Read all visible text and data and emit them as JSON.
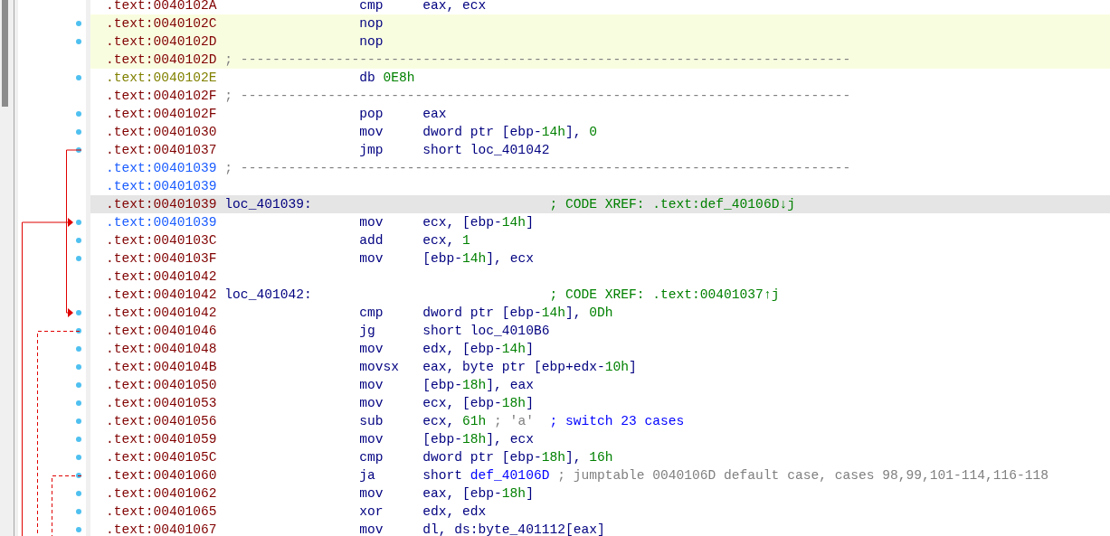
{
  "rows": [
    {
      "address": ".text:0040102A",
      "color": "#800000",
      "kind": "instruction",
      "marker": false,
      "marked": false,
      "selected": false,
      "mnemonic": "cmp",
      "operands": [
        {
          "text": "eax, ecx",
          "kind": "text"
        }
      ]
    },
    {
      "address": ".text:0040102C",
      "color": "#800000",
      "kind": "instruction",
      "marker": true,
      "marked": true,
      "selected": false,
      "mnemonic": "nop"
    },
    {
      "address": ".text:0040102D",
      "color": "#800000",
      "kind": "instruction",
      "marker": true,
      "marked": true,
      "selected": false,
      "mnemonic": "nop"
    },
    {
      "address": ".text:0040102D",
      "color": "#800000",
      "kind": "separator",
      "marker": false,
      "marked": true,
      "selected": false,
      "comments": [
        {
          "text": "; -----------------------------------------------------------------------------",
          "kind": "auto"
        }
      ]
    },
    {
      "address": ".text:0040102E",
      "color": "#808000",
      "kind": "data",
      "marker": true,
      "marked": false,
      "selected": false,
      "mnemonic": "db",
      "operands": [
        {
          "text": "0E8h",
          "kind": "number"
        }
      ]
    },
    {
      "address": ".text:0040102F",
      "color": "#800000",
      "kind": "separator",
      "marker": false,
      "marked": false,
      "selected": false,
      "comments": [
        {
          "text": "; -----------------------------------------------------------------------------",
          "kind": "auto"
        }
      ]
    },
    {
      "address": ".text:0040102F",
      "color": "#800000",
      "kind": "instruction",
      "marker": true,
      "marked": false,
      "selected": false,
      "mnemonic": "pop",
      "operands": [
        {
          "text": "eax",
          "kind": "text"
        }
      ]
    },
    {
      "address": ".text:00401030",
      "color": "#800000",
      "kind": "instruction",
      "marker": true,
      "marked": false,
      "selected": false,
      "mnemonic": "mov",
      "operands": [
        {
          "text": "dword ptr [ebp-",
          "kind": "text"
        },
        {
          "text": "14h",
          "kind": "number"
        },
        {
          "text": "], ",
          "kind": "text"
        },
        {
          "text": "0",
          "kind": "number"
        }
      ]
    },
    {
      "address": ".text:00401037",
      "color": "#800000",
      "kind": "instruction",
      "marker": true,
      "marked": false,
      "selected": false,
      "mnemonic": "jmp",
      "operands": [
        {
          "text": "short loc_401042",
          "kind": "text"
        }
      ]
    },
    {
      "address": ".text:00401039",
      "color": "#1a5cff",
      "kind": "separator",
      "marker": false,
      "marked": false,
      "selected": false,
      "comments": [
        {
          "text": "; -----------------------------------------------------------------------------",
          "kind": "auto"
        }
      ]
    },
    {
      "address": ".text:00401039",
      "color": "#1a5cff",
      "kind": "blank",
      "marker": false,
      "marked": false,
      "selected": false
    },
    {
      "address": ".text:00401039",
      "color": "#800000",
      "kind": "label",
      "marker": false,
      "marked": false,
      "selected": true,
      "label": "loc_401039:",
      "comments": [
        {
          "text": "; CODE XREF: .text:def_40106D↓j",
          "kind": "xref"
        }
      ]
    },
    {
      "address": ".text:00401039",
      "color": "#1a5cff",
      "kind": "instruction",
      "marker": true,
      "marked": false,
      "selected": false,
      "mnemonic": "mov",
      "operands": [
        {
          "text": "ecx, [ebp-",
          "kind": "text"
        },
        {
          "text": "14h",
          "kind": "number"
        },
        {
          "text": "]",
          "kind": "text"
        }
      ]
    },
    {
      "address": ".text:0040103C",
      "color": "#800000",
      "kind": "instruction",
      "marker": true,
      "marked": false,
      "selected": false,
      "mnemonic": "add",
      "operands": [
        {
          "text": "ecx, ",
          "kind": "text"
        },
        {
          "text": "1",
          "kind": "number"
        }
      ]
    },
    {
      "address": ".text:0040103F",
      "color": "#800000",
      "kind": "instruction",
      "marker": true,
      "marked": false,
      "selected": false,
      "mnemonic": "mov",
      "operands": [
        {
          "text": "[ebp-",
          "kind": "text"
        },
        {
          "text": "14h",
          "kind": "number"
        },
        {
          "text": "], ecx",
          "kind": "text"
        }
      ]
    },
    {
      "address": ".text:00401042",
      "color": "#800000",
      "kind": "blank",
      "marker": false,
      "marked": false,
      "selected": false
    },
    {
      "address": ".text:00401042",
      "color": "#800000",
      "kind": "label",
      "marker": false,
      "marked": false,
      "selected": false,
      "label": "loc_401042:",
      "comments": [
        {
          "text": "; CODE XREF: .text:00401037↑j",
          "kind": "xref"
        }
      ]
    },
    {
      "address": ".text:00401042",
      "color": "#800000",
      "kind": "instruction",
      "marker": true,
      "marked": false,
      "selected": false,
      "mnemonic": "cmp",
      "operands": [
        {
          "text": "dword ptr [ebp-",
          "kind": "text"
        },
        {
          "text": "14h",
          "kind": "number"
        },
        {
          "text": "], ",
          "kind": "text"
        },
        {
          "text": "0Dh",
          "kind": "number"
        }
      ]
    },
    {
      "address": ".text:00401046",
      "color": "#800000",
      "kind": "instruction",
      "marker": true,
      "marked": false,
      "selected": false,
      "mnemonic": "jg",
      "operands": [
        {
          "text": "short loc_4010B6",
          "kind": "text"
        }
      ]
    },
    {
      "address": ".text:00401048",
      "color": "#800000",
      "kind": "instruction",
      "marker": true,
      "marked": false,
      "selected": false,
      "mnemonic": "mov",
      "operands": [
        {
          "text": "edx, [ebp-",
          "kind": "text"
        },
        {
          "text": "14h",
          "kind": "number"
        },
        {
          "text": "]",
          "kind": "text"
        }
      ]
    },
    {
      "address": ".text:0040104B",
      "color": "#800000",
      "kind": "instruction",
      "marker": true,
      "marked": false,
      "selected": false,
      "mnemonic": "movsx",
      "operands": [
        {
          "text": "eax, byte ptr [ebp+edx-",
          "kind": "text"
        },
        {
          "text": "10h",
          "kind": "number"
        },
        {
          "text": "]",
          "kind": "text"
        }
      ]
    },
    {
      "address": ".text:00401050",
      "color": "#800000",
      "kind": "instruction",
      "marker": true,
      "marked": false,
      "selected": false,
      "mnemonic": "mov",
      "operands": [
        {
          "text": "[ebp-",
          "kind": "text"
        },
        {
          "text": "18h",
          "kind": "number"
        },
        {
          "text": "], eax",
          "kind": "text"
        }
      ]
    },
    {
      "address": ".text:00401053",
      "color": "#800000",
      "kind": "instruction",
      "marker": true,
      "marked": false,
      "selected": false,
      "mnemonic": "mov",
      "operands": [
        {
          "text": "ecx, [ebp-",
          "kind": "text"
        },
        {
          "text": "18h",
          "kind": "number"
        },
        {
          "text": "]",
          "kind": "text"
        }
      ]
    },
    {
      "address": ".text:00401056",
      "color": "#800000",
      "kind": "instruction",
      "marker": true,
      "marked": false,
      "selected": false,
      "mnemonic": "sub",
      "operands": [
        {
          "text": "ecx, ",
          "kind": "text"
        },
        {
          "text": "61h",
          "kind": "number"
        },
        {
          "text": "; 'a'",
          "kind": "note"
        }
      ],
      "comments": [
        {
          "text": "; switch 23 cases",
          "kind": "user"
        }
      ]
    },
    {
      "address": ".text:00401059",
      "color": "#800000",
      "kind": "instruction",
      "marker": true,
      "marked": false,
      "selected": false,
      "mnemonic": "mov",
      "operands": [
        {
          "text": "[ebp-",
          "kind": "text"
        },
        {
          "text": "18h",
          "kind": "number"
        },
        {
          "text": "], ecx",
          "kind": "text"
        }
      ]
    },
    {
      "address": ".text:0040105C",
      "color": "#800000",
      "kind": "instruction",
      "marker": true,
      "marked": false,
      "selected": false,
      "mnemonic": "cmp",
      "operands": [
        {
          "text": "dword ptr [ebp-",
          "kind": "text"
        },
        {
          "text": "18h",
          "kind": "number"
        },
        {
          "text": "], ",
          "kind": "text"
        },
        {
          "text": "16h",
          "kind": "number"
        }
      ]
    },
    {
      "address": ".text:00401060",
      "color": "#800000",
      "kind": "instruction",
      "marker": true,
      "marked": false,
      "selected": false,
      "mnemonic": "ja",
      "operands": [
        {
          "text": "short ",
          "kind": "text"
        },
        {
          "text": "def_40106D",
          "kind": "ref"
        }
      ],
      "comments": [
        {
          "text": "; jumptable 0040106D default case, cases 98,99,101-114,116-118",
          "kind": "auto"
        }
      ]
    },
    {
      "address": ".text:00401062",
      "color": "#800000",
      "kind": "instruction",
      "marker": true,
      "marked": false,
      "selected": false,
      "mnemonic": "mov",
      "operands": [
        {
          "text": "eax, [ebp-",
          "kind": "text"
        },
        {
          "text": "18h",
          "kind": "number"
        },
        {
          "text": "]",
          "kind": "text"
        }
      ]
    },
    {
      "address": ".text:00401065",
      "color": "#800000",
      "kind": "instruction",
      "marker": true,
      "marked": false,
      "selected": false,
      "mnemonic": "xor",
      "operands": [
        {
          "text": "edx, edx",
          "kind": "text"
        }
      ]
    },
    {
      "address": ".text:00401067",
      "color": "#800000",
      "kind": "instruction",
      "marker": true,
      "marked": false,
      "selected": false,
      "mnemonic": "mov",
      "operands": [
        {
          "text": "dl, ds:byte_401112[eax]",
          "kind": "text"
        }
      ]
    }
  ]
}
